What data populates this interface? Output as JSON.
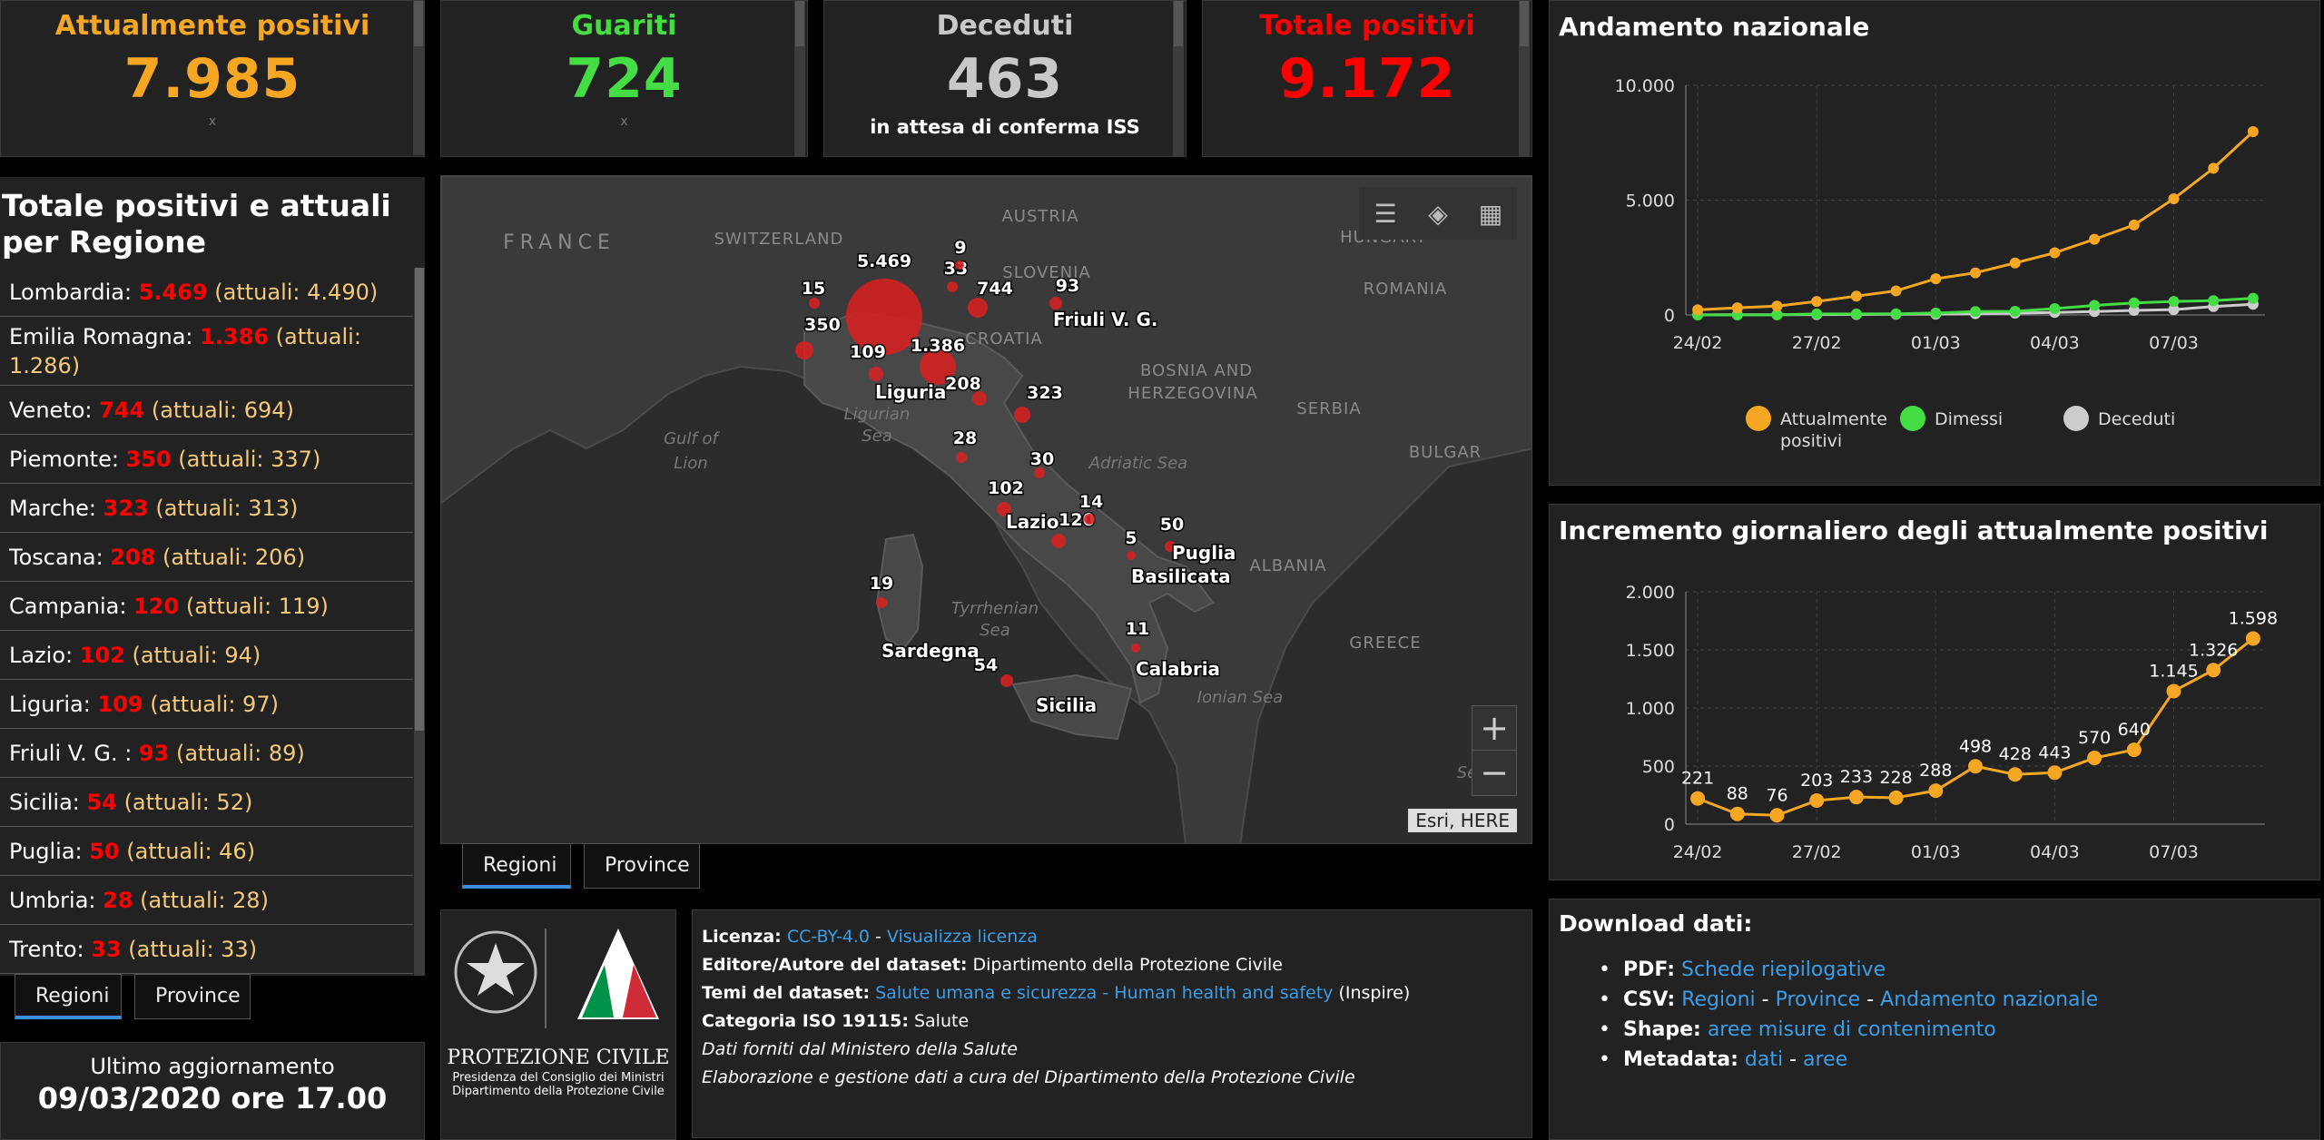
{
  "stats": [
    {
      "label": "Attualmente positivi",
      "value": "7.985",
      "color": "#f5a623",
      "note": "x"
    },
    {
      "label": "Guariti",
      "value": "724",
      "color": "#44dd44",
      "note": "x"
    },
    {
      "label": "Deceduti",
      "value": "463",
      "color": "#c8c8c8",
      "sub": "in attesa di conferma ISS"
    },
    {
      "label": "Totale positivi",
      "value": "9.172",
      "color": "#ff0000"
    }
  ],
  "regions_panel": {
    "title": "Totale positivi e attuali per Regione",
    "rows": [
      {
        "name": "Lombardia: ",
        "total": "5.469",
        "current": " (attuali: 4.490)"
      },
      {
        "name": "Emilia Romagna: ",
        "total": "1.386",
        "current": " (attuali: 1.286)"
      },
      {
        "name": "Veneto: ",
        "total": "744",
        "current": " (attuali: 694)"
      },
      {
        "name": "Piemonte: ",
        "total": "350",
        "current": " (attuali: 337)"
      },
      {
        "name": "Marche: ",
        "total": "323",
        "current": " (attuali: 313)"
      },
      {
        "name": "Toscana: ",
        "total": "208",
        "current": " (attuali: 206)"
      },
      {
        "name": "Campania: ",
        "total": "120",
        "current": " (attuali: 119)"
      },
      {
        "name": "Lazio: ",
        "total": "102",
        "current": " (attuali: 94)"
      },
      {
        "name": "Liguria: ",
        "total": "109",
        "current": " (attuali: 97)"
      },
      {
        "name": "Friuli V. G. : ",
        "total": "93",
        "current": " (attuali: 89)"
      },
      {
        "name": "Sicilia: ",
        "total": "54",
        "current": " (attuali: 52)"
      },
      {
        "name": "Puglia: ",
        "total": "50",
        "current": " (attuali: 46)"
      },
      {
        "name": "Umbria: ",
        "total": "28",
        "current": " (attuali: 28)"
      },
      {
        "name": "Trento: ",
        "total": "33",
        "current": " (attuali: 33)"
      }
    ],
    "tabs": [
      "Regioni",
      "Province"
    ]
  },
  "last_update": {
    "label": "Ultimo aggiornamento",
    "value": "09/03/2020 ore 17.00"
  },
  "map": {
    "tabs": [
      "Regioni",
      "Province"
    ],
    "attribution": "Esri, HERE",
    "zoom_in": "+",
    "zoom_out": "−",
    "countries": [
      "FRANCE",
      "SWITZERLAND",
      "AUSTRIA",
      "HUNGARY",
      "SLOVENIA",
      "CROATIA",
      "ROMANIA",
      "BOSNIA AND",
      "HERZEGOVINA",
      "SERBIA",
      "BULGAR",
      "ALBANIA",
      "GREECE"
    ],
    "seas": [
      "Gulf of",
      "Lion",
      "Ligurian",
      "Sea",
      "Adriatic Sea",
      "Tyrrhenian",
      "Sea",
      "Ionian Sea",
      "Se"
    ],
    "bubbles": [
      {
        "value": "5.469",
        "radius": 42
      },
      {
        "value": "1.386",
        "radius": 20
      },
      {
        "value": "744",
        "radius": 11
      },
      {
        "value": "350",
        "radius": 10
      },
      {
        "value": "323",
        "radius": 9
      },
      {
        "value": "208",
        "radius": 8
      },
      {
        "value": "120",
        "radius": 8
      },
      {
        "value": "109",
        "radius": 8
      },
      {
        "value": "102",
        "radius": 8
      },
      {
        "value": "93",
        "radius": 7
      },
      {
        "value": "54",
        "radius": 7
      },
      {
        "value": "50",
        "radius": 6
      },
      {
        "value": "33",
        "radius": 6
      },
      {
        "value": "30",
        "radius": 6
      },
      {
        "value": "28",
        "radius": 6
      },
      {
        "value": "19",
        "radius": 6
      },
      {
        "value": "15",
        "radius": 6
      },
      {
        "value": "14",
        "radius": 6
      },
      {
        "value": "11",
        "radius": 5
      },
      {
        "value": "9",
        "radius": 5
      },
      {
        "value": "5",
        "radius": 5
      }
    ],
    "region_labels": [
      "Liguria",
      "Friuli V. G.",
      "Lazio",
      "Puglia",
      "Basilicata",
      "Sardegna",
      "Calabria",
      "Sicilia"
    ]
  },
  "info": {
    "license_label": "Licenza:",
    "license_link": "CC-BY-4.0",
    "sep": " - ",
    "license_view": "Visualizza licenza",
    "author_label": "Editore/Autore del dataset:",
    "author": " Dipartimento della Protezione Civile",
    "themes_label": "Temi del dataset:",
    "themes_link": "Salute umana e sicurezza - Human health and safety",
    "themes_after": " (Inspire)",
    "iso_label": "Categoria ISO 19115:",
    "iso": " Salute",
    "line5": "Dati forniti dal Ministero della Salute",
    "line6": "Elaborazione e gestione dati a cura del Dipartimento della Protezione Civile",
    "logo_title": "PROTEZIONE CIVILE",
    "logo_sub1": "Presidenza del Consiglio dei Ministri",
    "logo_sub2": "Dipartimento della Protezione Civile",
    "colors": {
      "green": "#009246",
      "red": "#ce2b37",
      "white": "#ffffff"
    }
  },
  "download": {
    "title": "Download dati:",
    "pdf_label": "PDF:",
    "pdf_link": "Schede riepilogative",
    "csv_label": "CSV:",
    "csv_link1": "Regioni",
    "csv_link2": "Province",
    "csv_link3": "Andamento nazionale",
    "shape_label": "Shape:",
    "shape_link": "aree misure di contenimento",
    "meta_label": "Metadata:",
    "meta_link1": "dati",
    "meta_link2": "aree",
    "dash": " - "
  },
  "chart_data": [
    {
      "type": "line",
      "title": "Andamento nazionale",
      "x": [
        "24/02",
        "25/02",
        "26/02",
        "27/02",
        "28/02",
        "29/02",
        "01/03",
        "02/03",
        "03/03",
        "04/03",
        "05/03",
        "06/03",
        "07/03",
        "08/03",
        "09/03"
      ],
      "xticks": [
        "24/02",
        "27/02",
        "01/03",
        "04/03",
        "07/03"
      ],
      "yticks": [
        "0",
        "5.000",
        "10.000"
      ],
      "ylim": [
        0,
        10000
      ],
      "series": [
        {
          "name": "Attualmente positivi",
          "color": "#f5a623",
          "values": [
            221,
            311,
            385,
            588,
            821,
            1049,
            1577,
            1835,
            2263,
            2706,
            3296,
            3916,
            5061,
            6387,
            7985
          ]
        },
        {
          "name": "Dimessi",
          "color": "#44dd44",
          "values": [
            1,
            1,
            3,
            45,
            46,
            50,
            83,
            149,
            160,
            276,
            414,
            523,
            589,
            622,
            724
          ]
        },
        {
          "name": "Deceduti",
          "color": "#cccccc",
          "values": [
            7,
            10,
            12,
            17,
            21,
            29,
            34,
            52,
            79,
            107,
            148,
            197,
            233,
            366,
            463
          ]
        }
      ],
      "legend": "bottom",
      "legend_labels": [
        [
          "Attualmente",
          "positivi"
        ],
        [
          "Dimessi"
        ],
        [
          "Deceduti"
        ]
      ],
      "grid": true
    },
    {
      "type": "line",
      "title": "Incremento giornaliero degli attualmente positivi",
      "x": [
        "24/02",
        "25/02",
        "26/02",
        "27/02",
        "28/02",
        "29/02",
        "01/03",
        "02/03",
        "03/03",
        "04/03",
        "05/03",
        "06/03",
        "07/03",
        "08/03",
        "09/03"
      ],
      "xticks": [
        "24/02",
        "27/02",
        "01/03",
        "04/03",
        "07/03"
      ],
      "yticks": [
        "0",
        "500",
        "1.000",
        "1.500",
        "2.000"
      ],
      "ylim": [
        0,
        2000
      ],
      "series": [
        {
          "name": "",
          "color": "#f5a623",
          "values": [
            221,
            88,
            76,
            203,
            233,
            228,
            288,
            498,
            428,
            443,
            570,
            640,
            1145,
            1326,
            1598
          ],
          "labels": [
            "221",
            "88",
            "76",
            "203",
            "233",
            "228",
            "288",
            "498",
            "428",
            "443",
            "570",
            "640",
            "1.145",
            "1.326",
            "1.598"
          ]
        }
      ],
      "grid": true
    }
  ]
}
